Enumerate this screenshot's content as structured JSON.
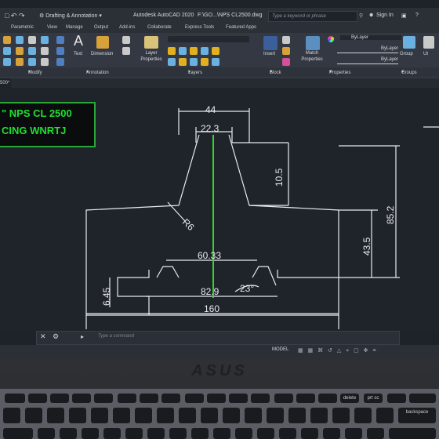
{
  "titlebar": {
    "workspace": "Drafting & Annotation",
    "app_title": "Autodesk AutoCAD 2020",
    "file_path": "F:\\GO...\\NPS CL2500.dwg",
    "search_placeholder": "Type a keyword or phrase",
    "signin": "Sign In"
  },
  "tabs": [
    "Parametric",
    "View",
    "Manage",
    "Output",
    "Add-ins",
    "Collaborate",
    "Express Tools",
    "Featured Apps"
  ],
  "ribbon": {
    "text_label": "Text",
    "dimension_label": "Dimension",
    "layer_properties_label": "Layer Properties",
    "insert_label": "Insert",
    "match_properties_label": "Match Properties",
    "bylayer_1": "ByLayer",
    "bylayer_2": "ByLayer",
    "bylayer_3": "ByLayer",
    "group_label": "Group",
    "utilities_label": "Ut"
  },
  "panels": [
    "Modify",
    "Annotation",
    "Layers",
    "Block",
    "Properties",
    "Groups"
  ],
  "filetab": "500*",
  "note": {
    "line1": "\" NPS CL 2500",
    "line2": "CING WNRTJ"
  },
  "dimensions": {
    "d44": "44",
    "d22": "22.3",
    "d105": "10.5",
    "d852": "85.2",
    "d435": "43.5",
    "d6033": "60.33",
    "d829": "82.9",
    "d23": "23°",
    "d645": "6.45",
    "d160": "160",
    "r6": "R6"
  },
  "command": {
    "placeholder": "Type a command"
  },
  "status": {
    "model": "MODEL"
  },
  "laptop": {
    "brand": "ASUS",
    "backspace": "backspace",
    "delete": "delete",
    "prtsc": "prt sc"
  }
}
